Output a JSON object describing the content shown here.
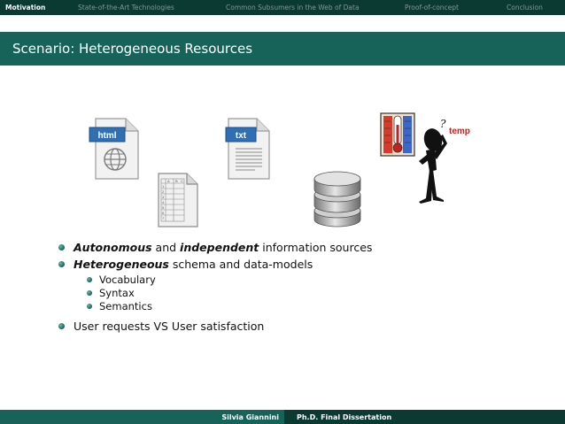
{
  "nav": {
    "items": [
      {
        "label": "Motivation",
        "active": true
      },
      {
        "label": "State-of-the-Art Technologies",
        "active": false
      },
      {
        "label": "Common Subsumers in the Web of Data",
        "active": false
      },
      {
        "label": "Proof-of-concept",
        "active": false
      },
      {
        "label": "Conclusion",
        "active": false
      }
    ]
  },
  "slide": {
    "title": "Scenario: Heterogeneous Resources"
  },
  "illustrations": {
    "html_tag": "html",
    "txt_tag": "txt",
    "temp_label": "temp",
    "question_mark": "?",
    "spreadsheet_cols": [
      "A",
      "B",
      "C"
    ],
    "spreadsheet_rows": [
      "1",
      "2",
      "3",
      "4",
      "5",
      "6",
      "7"
    ],
    "icons": [
      "html-document-icon",
      "spreadsheet-icon",
      "txt-document-icon",
      "database-icon",
      "thermometer-icon",
      "thinking-person-icon"
    ]
  },
  "bullets": {
    "b1": {
      "emph1": "Autonomous",
      "t1": " and ",
      "emph2": "independent",
      "t2": " information sources"
    },
    "b2": {
      "emph1": "Heterogeneous",
      "t1": " schema and data-models"
    },
    "sub": [
      "Vocabulary",
      "Syntax",
      "Semantics"
    ],
    "b3": {
      "t1": "User requests VS User satisfaction"
    }
  },
  "footer": {
    "author": "Silvia Giannini",
    "talk": "Ph.D. Final Dissertation"
  },
  "colors": {
    "nav_bg": "#0b3a33",
    "title_bg": "#17635a",
    "accent_red": "#c0221e"
  }
}
